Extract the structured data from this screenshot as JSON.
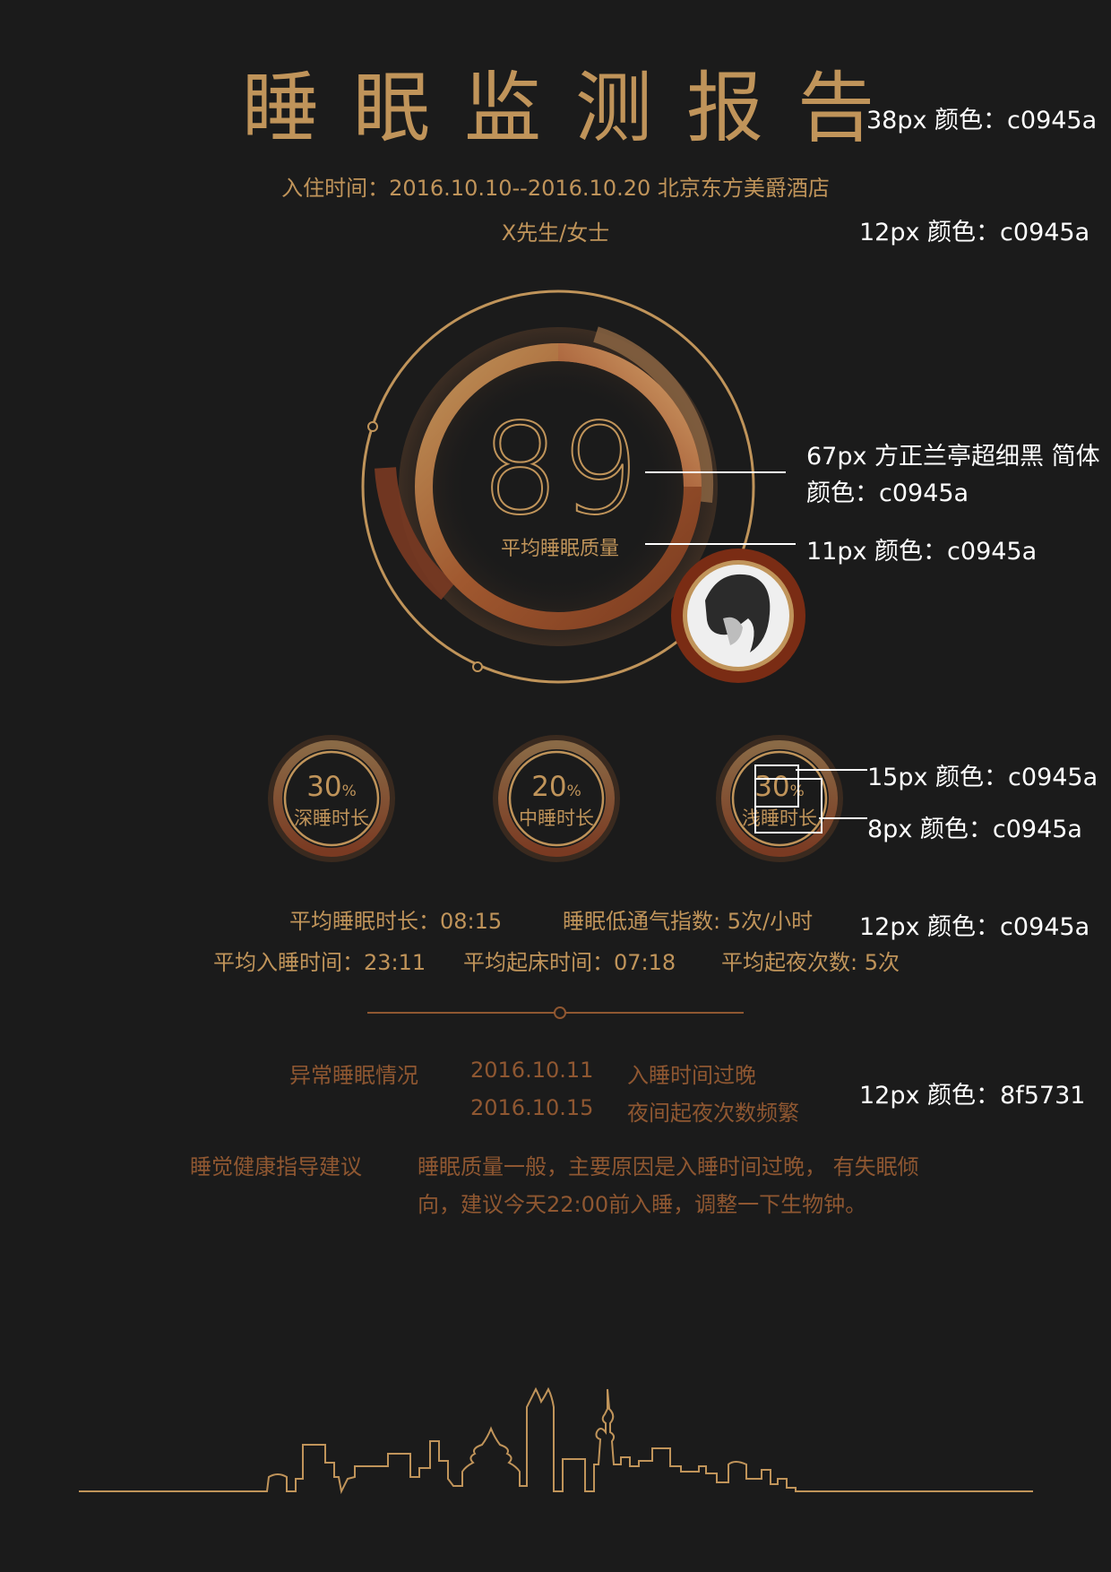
{
  "header": {
    "title": "睡眠监测报告",
    "stay_info": "入住时间：2016.10.10--2016.10.20 北京东方美爵酒店",
    "guest_name": "X先生/女士"
  },
  "annotations": {
    "title_spec": "38px 颜色：c0945a",
    "subtitle_spec": "12px   颜色：c0945a",
    "score_spec_line1": "67px 方正兰亭超细黑 简体",
    "score_spec_line2": "颜色：c0945a",
    "score_label_spec": "11px   颜色：c0945a",
    "ring_num_spec": "15px   颜色：c0945a",
    "ring_label_spec": "8px   颜色：c0945a",
    "stats_spec": "12px   颜色：c0945a",
    "abnormal_spec": "12px   颜色：8f5731"
  },
  "score": {
    "value": "89",
    "label": "平均睡眠质量"
  },
  "rings": [
    {
      "percent": "30",
      "unit": "%",
      "label": "深睡时长"
    },
    {
      "percent": "20",
      "unit": "%",
      "label": "中睡时长"
    },
    {
      "percent": "30",
      "unit": "%",
      "label": "浅睡时长"
    }
  ],
  "stats": {
    "avg_duration": "平均睡眠时长：08:15",
    "hypopnea": "睡眠低通气指数: 5次/小时",
    "avg_sleep_time": "平均入睡时间：23:11",
    "avg_wake_time": "平均起床时间：07:18",
    "night_wakes": "平均起夜次数: 5次"
  },
  "abnormal": {
    "title": "异常睡眠情况",
    "items": [
      {
        "date": "2016.10.11",
        "desc": "入睡时间过晚"
      },
      {
        "date": "2016.10.15",
        "desc": "夜间起夜次数频繁"
      }
    ]
  },
  "advice": {
    "title": "睡觉健康指导建议",
    "line1": "睡眠质量一般，主要原因是入睡时间过晚， 有失眠倾",
    "line2": "向，建议今天22:00前入睡，调整一下生物钟。"
  },
  "colors": {
    "gold": "#c0945a",
    "rust": "#8f5731",
    "background": "#1b1b1b"
  }
}
